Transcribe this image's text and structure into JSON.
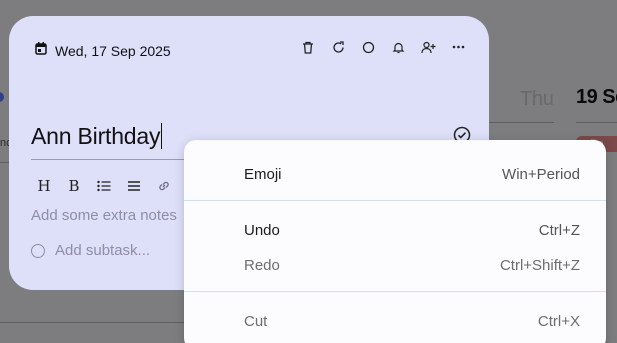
{
  "background": {
    "day_thu": "Thu",
    "day_19": "19 Se",
    "pill_text": "Be",
    "left_fragment": "nc"
  },
  "card": {
    "date": "Wed, 17 Sep 2025",
    "title": "Ann Birthday",
    "notes_placeholder": "Add some extra notes",
    "subtask_placeholder": "Add subtask...",
    "toolbar": {
      "heading": "H",
      "bold": "B"
    },
    "colors": {
      "card_bg": "#dedff9",
      "placeholder": "#8d8da6"
    }
  },
  "context_menu": {
    "items": [
      {
        "label": "Emoji",
        "shortcut": "Win+Period"
      },
      {
        "label": "Undo",
        "shortcut": "Ctrl+Z"
      },
      {
        "label": "Redo",
        "shortcut": "Ctrl+Shift+Z",
        "disabled": true
      },
      {
        "label": "Cut",
        "shortcut": "Ctrl+X",
        "disabled": true
      }
    ]
  }
}
